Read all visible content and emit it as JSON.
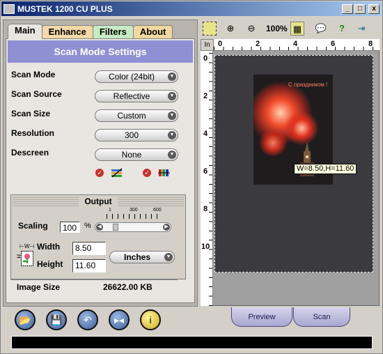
{
  "window": {
    "title": "MUSTEK 1200 CU PLUS",
    "minimize": "_",
    "maximize": "□",
    "close": "x"
  },
  "tabs": [
    "Main",
    "Enhance",
    "Filters",
    "About"
  ],
  "header": "Scan Mode Settings",
  "settings": [
    {
      "label": "Scan Mode",
      "value": "Color (24bit)"
    },
    {
      "label": "Scan Source",
      "value": "Reflective"
    },
    {
      "label": "Scan Size",
      "value": "Custom"
    },
    {
      "label": "Resolution",
      "value": "300"
    },
    {
      "label": "Descreen",
      "value": "None"
    }
  ],
  "output": {
    "title": "Output",
    "scaling_label": "Scaling",
    "scaling_value": "100",
    "scaling_unit": "%",
    "scale_ticks": [
      "1",
      "300",
      "600"
    ],
    "scale_level": 0.17,
    "width_label": "Width",
    "width_value": "8.50",
    "height_label": "Height",
    "height_value": "11.60",
    "unit": "Inches",
    "wh_arrow_w": "⊢W⊣",
    "wh_arrow_h": "H"
  },
  "image_size": {
    "label": "Image Size",
    "value": "26622.00 KB"
  },
  "toolbar": {
    "zoom_label": "100%"
  },
  "ruler": {
    "unit": "In",
    "top": [
      "0",
      "2",
      "4",
      "6",
      "8"
    ],
    "left": [
      "0",
      "2",
      "4",
      "6",
      "8",
      "10"
    ]
  },
  "photo_text": "С праздником !",
  "tooltip": "W=8.50,H=11.60",
  "buttons": {
    "preview": "Preview",
    "scan": "Scan"
  },
  "colors": {
    "header_bg": "#8f8fd4",
    "titlebar": "#0a246a",
    "scan_area": "#3b3a3e"
  }
}
